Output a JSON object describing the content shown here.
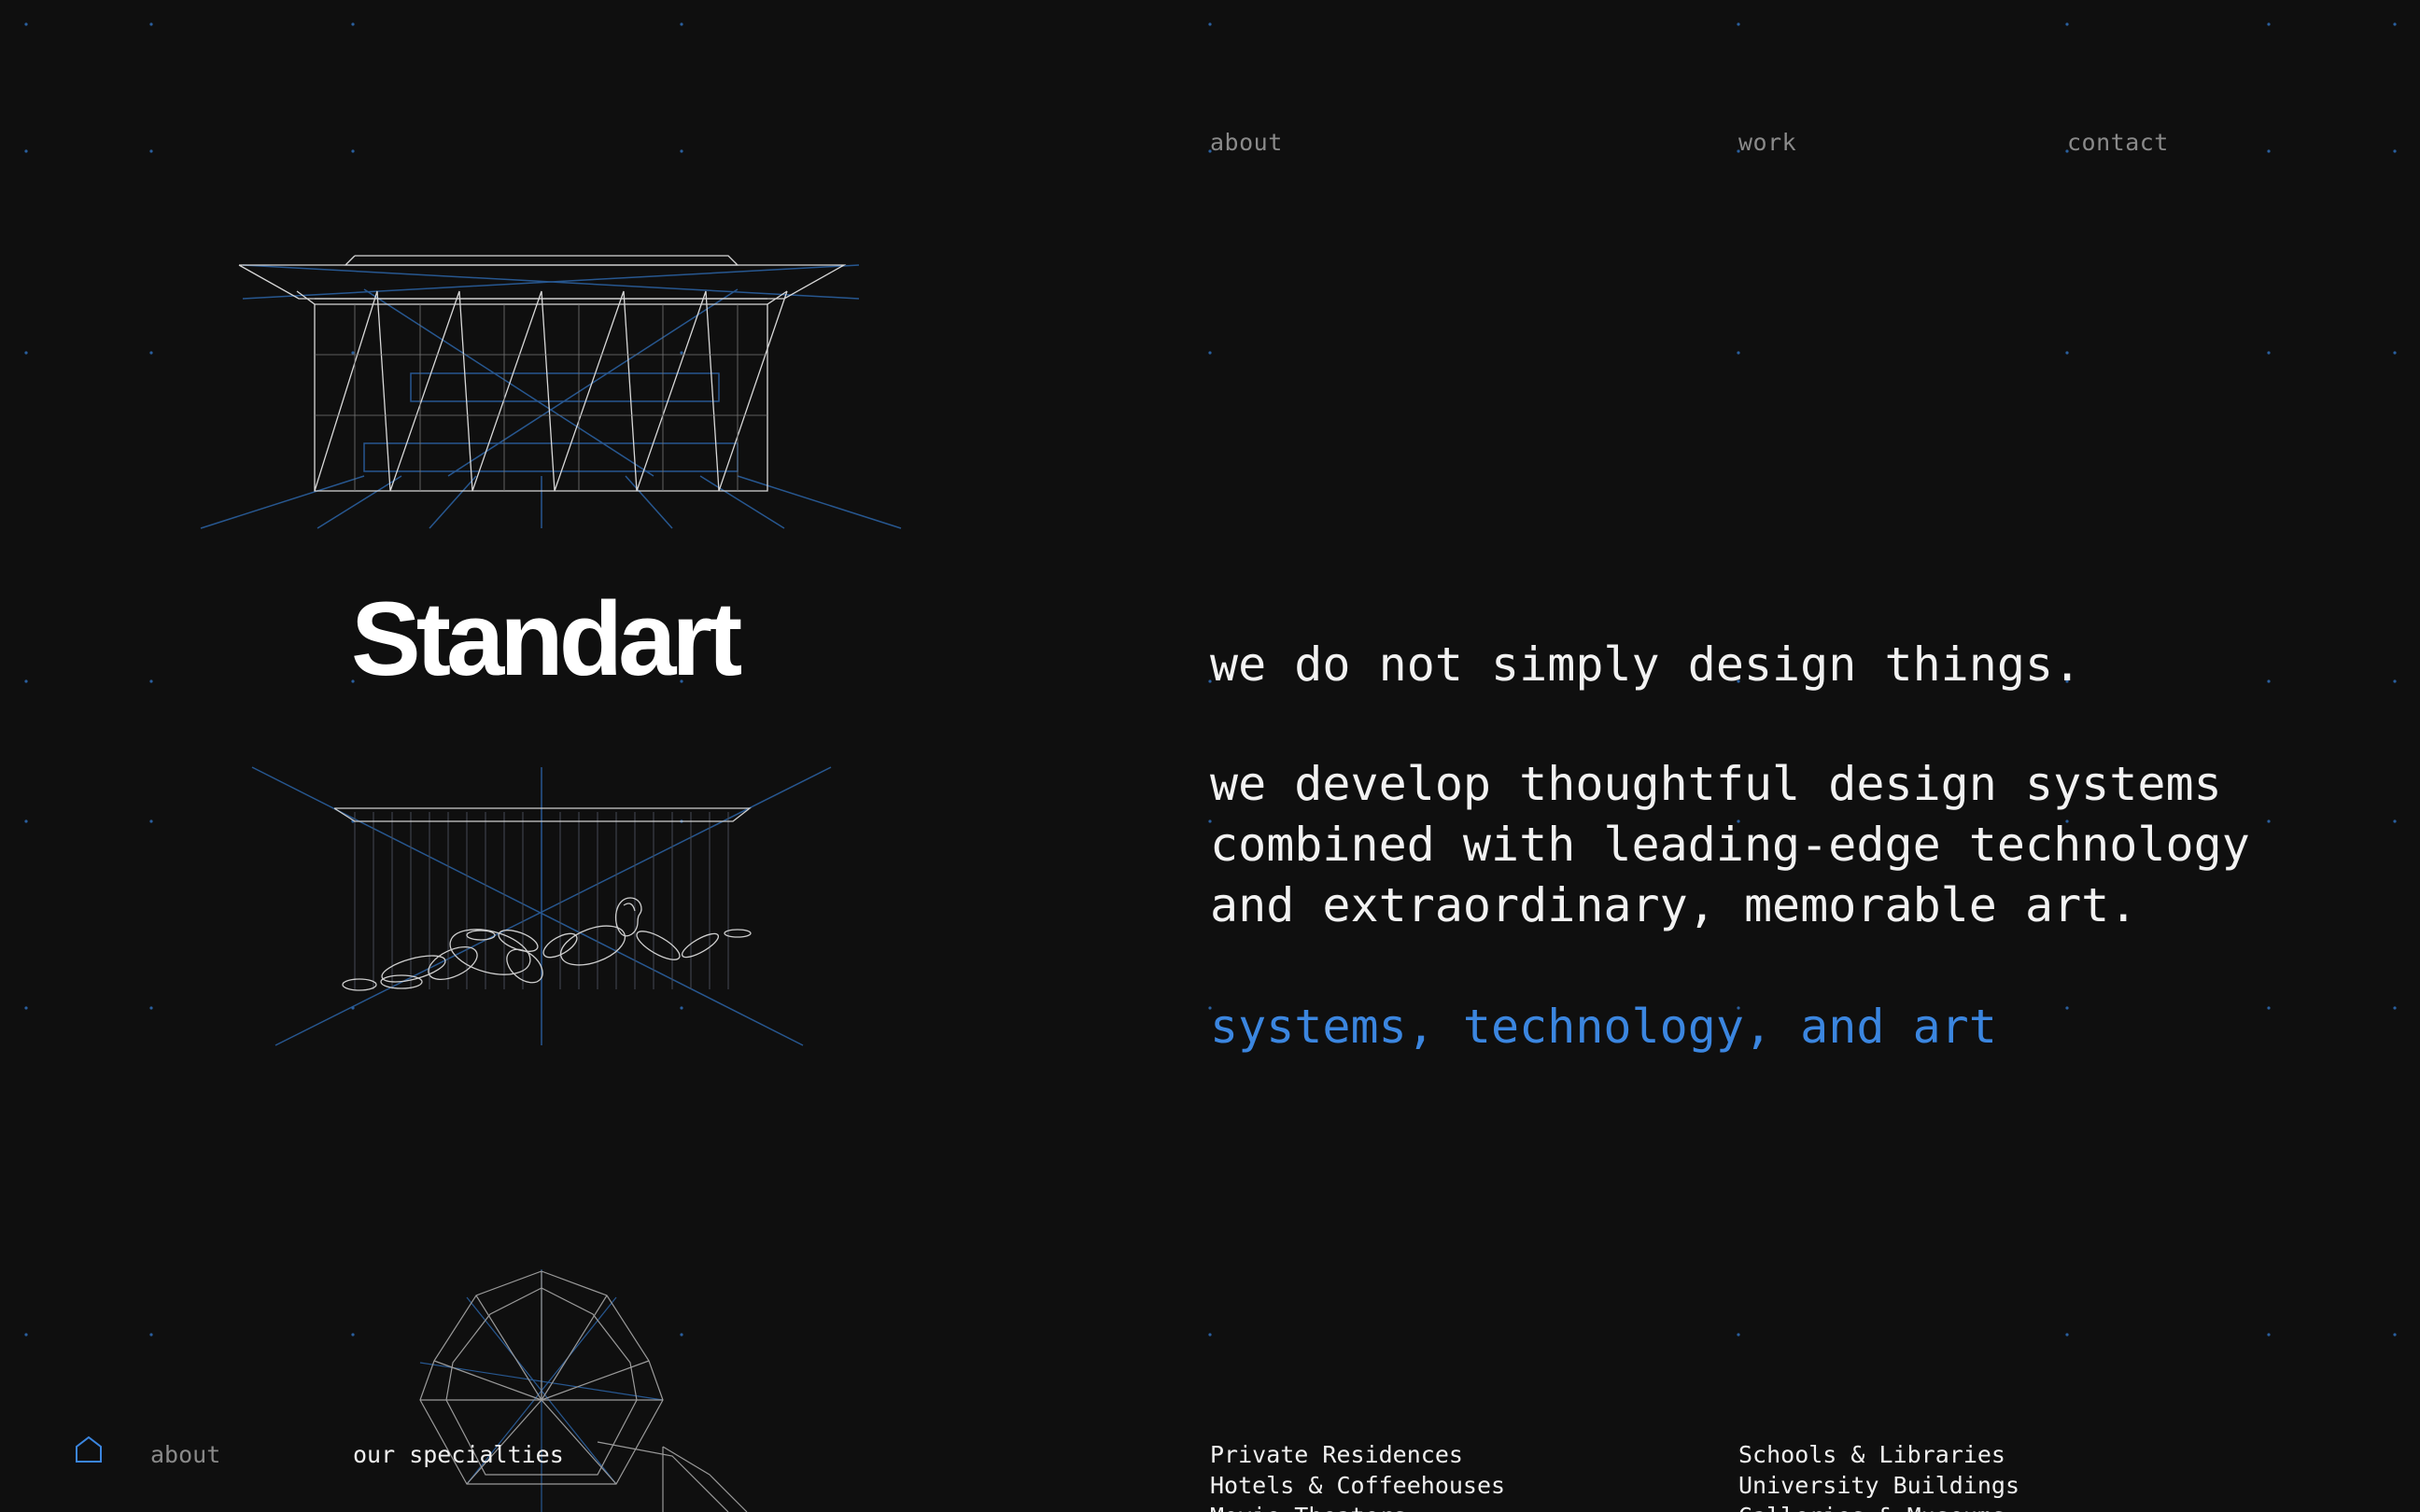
{
  "nav": {
    "about": "about",
    "work": "work",
    "contact": "contact"
  },
  "brand": {
    "logo_text": "Standart"
  },
  "hero": {
    "line1": "we do not simply design things.",
    "paragraph": [
      "we develop thoughtful design systems",
      "combined with leading-edge technology",
      "and extraordinary, memorable art."
    ],
    "tagline": "systems, technology, and art"
  },
  "footer": {
    "home_icon": "home-icon",
    "about": "about",
    "specialties_label": "our specialties",
    "specialties_col1": [
      "Private Residences",
      "Hotels & Coffeehouses",
      "Movie Theaters"
    ],
    "specialties_col2": [
      "Schools & Libraries",
      "University Buildings",
      "Galleries & Museums"
    ]
  },
  "colors": {
    "background": "#0f0f0f",
    "accent": "#3b86e0",
    "text": "#f2f2f2",
    "muted": "#8a8a8a",
    "line_blue": "#2a5f9e"
  }
}
